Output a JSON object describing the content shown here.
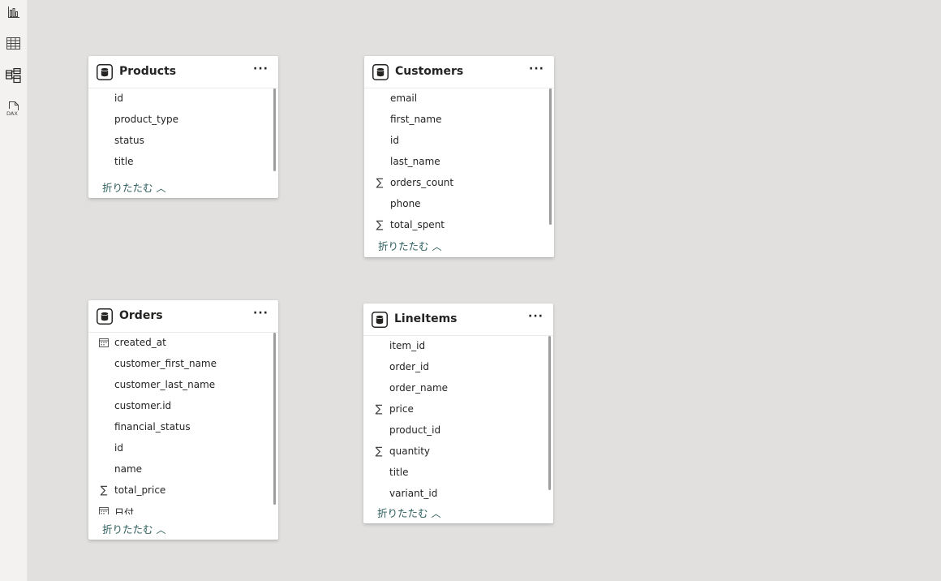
{
  "rail": {
    "icons": [
      "report-view-icon",
      "table-view-icon",
      "model-view-icon",
      "dax-query-view-icon"
    ],
    "dax_label": "DAX"
  },
  "collapse_label": "折りたたむ",
  "tables": {
    "products": {
      "title": "Products",
      "more": "···",
      "fields": [
        "id",
        "product_type",
        "status",
        "title"
      ]
    },
    "customers": {
      "title": "Customers",
      "more": "···",
      "fields": [
        "email",
        "first_name",
        "id",
        "last_name",
        "orders_count",
        "phone",
        "total_spent"
      ]
    },
    "orders": {
      "title": "Orders",
      "more": "···",
      "fields": [
        "created_at",
        "customer_first_name",
        "customer_last_name",
        "customer.id",
        "financial_status",
        "id",
        "name",
        "total_price",
        "日付"
      ]
    },
    "lineitems": {
      "title": "LineItems",
      "more": "···",
      "fields": [
        "item_id",
        "order_id",
        "order_name",
        "price",
        "product_id",
        "quantity",
        "title",
        "variant_id"
      ]
    }
  },
  "field_types": {
    "orders_count": "sum-icon",
    "total_spent": "sum-icon",
    "total_price": "sum-icon",
    "price": "sum-icon",
    "quantity": "sum-icon",
    "created_at": "calendar-icon",
    "日付": "calendar-icon"
  }
}
